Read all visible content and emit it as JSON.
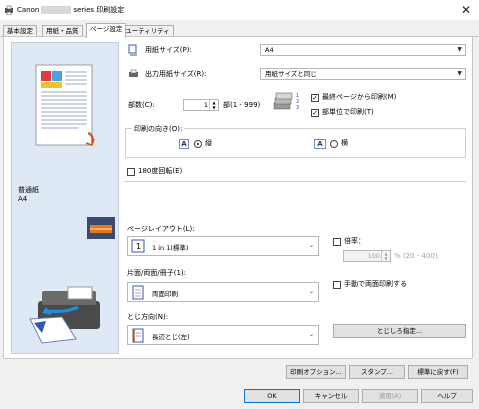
{
  "window": {
    "title_prefix": "Canon",
    "title_suffix": "series 印刷設定",
    "close_glyph": "✕"
  },
  "tabs": [
    {
      "label": "基本設定",
      "active": false
    },
    {
      "label": "用紙・品質",
      "active": false
    },
    {
      "label": "ページ設定",
      "active": true
    },
    {
      "label": "ユーティリティ",
      "active": false
    }
  ],
  "preview": {
    "media_type": "普通紙",
    "paper_size": "A4"
  },
  "page_setup": {
    "paper_size_label": "用紙サイズ(P):",
    "paper_size_value": "A4",
    "output_size_label": "出力用紙サイズ(R):",
    "output_size_value": "用紙サイズと同じ",
    "copies_label": "部数(C):",
    "copies_value": "1",
    "copies_range": "部(1 - 999)",
    "reverse_order_label": "最終ページから印刷(M)",
    "reverse_order_checked": true,
    "collate_label": "部単位で印刷(T)",
    "collate_checked": true,
    "orientation_label": "印刷の向き(O):",
    "portrait_label": "縦",
    "landscape_label": "横",
    "orientation_selected": "portrait",
    "rotate_label": "180度回転(E)",
    "rotate_checked": false,
    "layout_label": "ページレイアウト(L):",
    "layout_value": "1 in 1(標準)",
    "scaling_label": "倍率：",
    "scaling_checked": false,
    "scaling_value": "100",
    "scaling_range": "% (20 - 400)",
    "duplex_label": "片面/両面/冊子(1):",
    "duplex_value": "両面印刷",
    "manual_duplex_label": "手動で両面印刷する",
    "manual_duplex_checked": false,
    "binding_label": "とじ方向(N):",
    "binding_value": "長辺とじ(左)",
    "margin_button": "とじしろ指定..."
  },
  "bottom_buttons": {
    "print_options": "印刷オプション...",
    "stamp": "スタンプ...",
    "defaults": "標準に戻す(F)"
  },
  "dialog_buttons": {
    "ok": "OK",
    "cancel": "キャンセル",
    "apply": "適用(A)",
    "help": "ヘルプ"
  },
  "icons": {
    "app": "printer-settings-icon",
    "paper_size": "paper-size-icon",
    "output_size": "output-paper-icon",
    "copies": "collate-stack-icon",
    "orientation_portrait": "letter-a-portrait-icon",
    "orientation_landscape": "letter-a-landscape-icon",
    "layout": "layout-1in1-icon",
    "duplex": "duplex-page-icon",
    "binding": "binding-page-icon"
  },
  "colors": {
    "preview_bg": "#dfe9f5",
    "accent_blue": "#0078d7"
  }
}
